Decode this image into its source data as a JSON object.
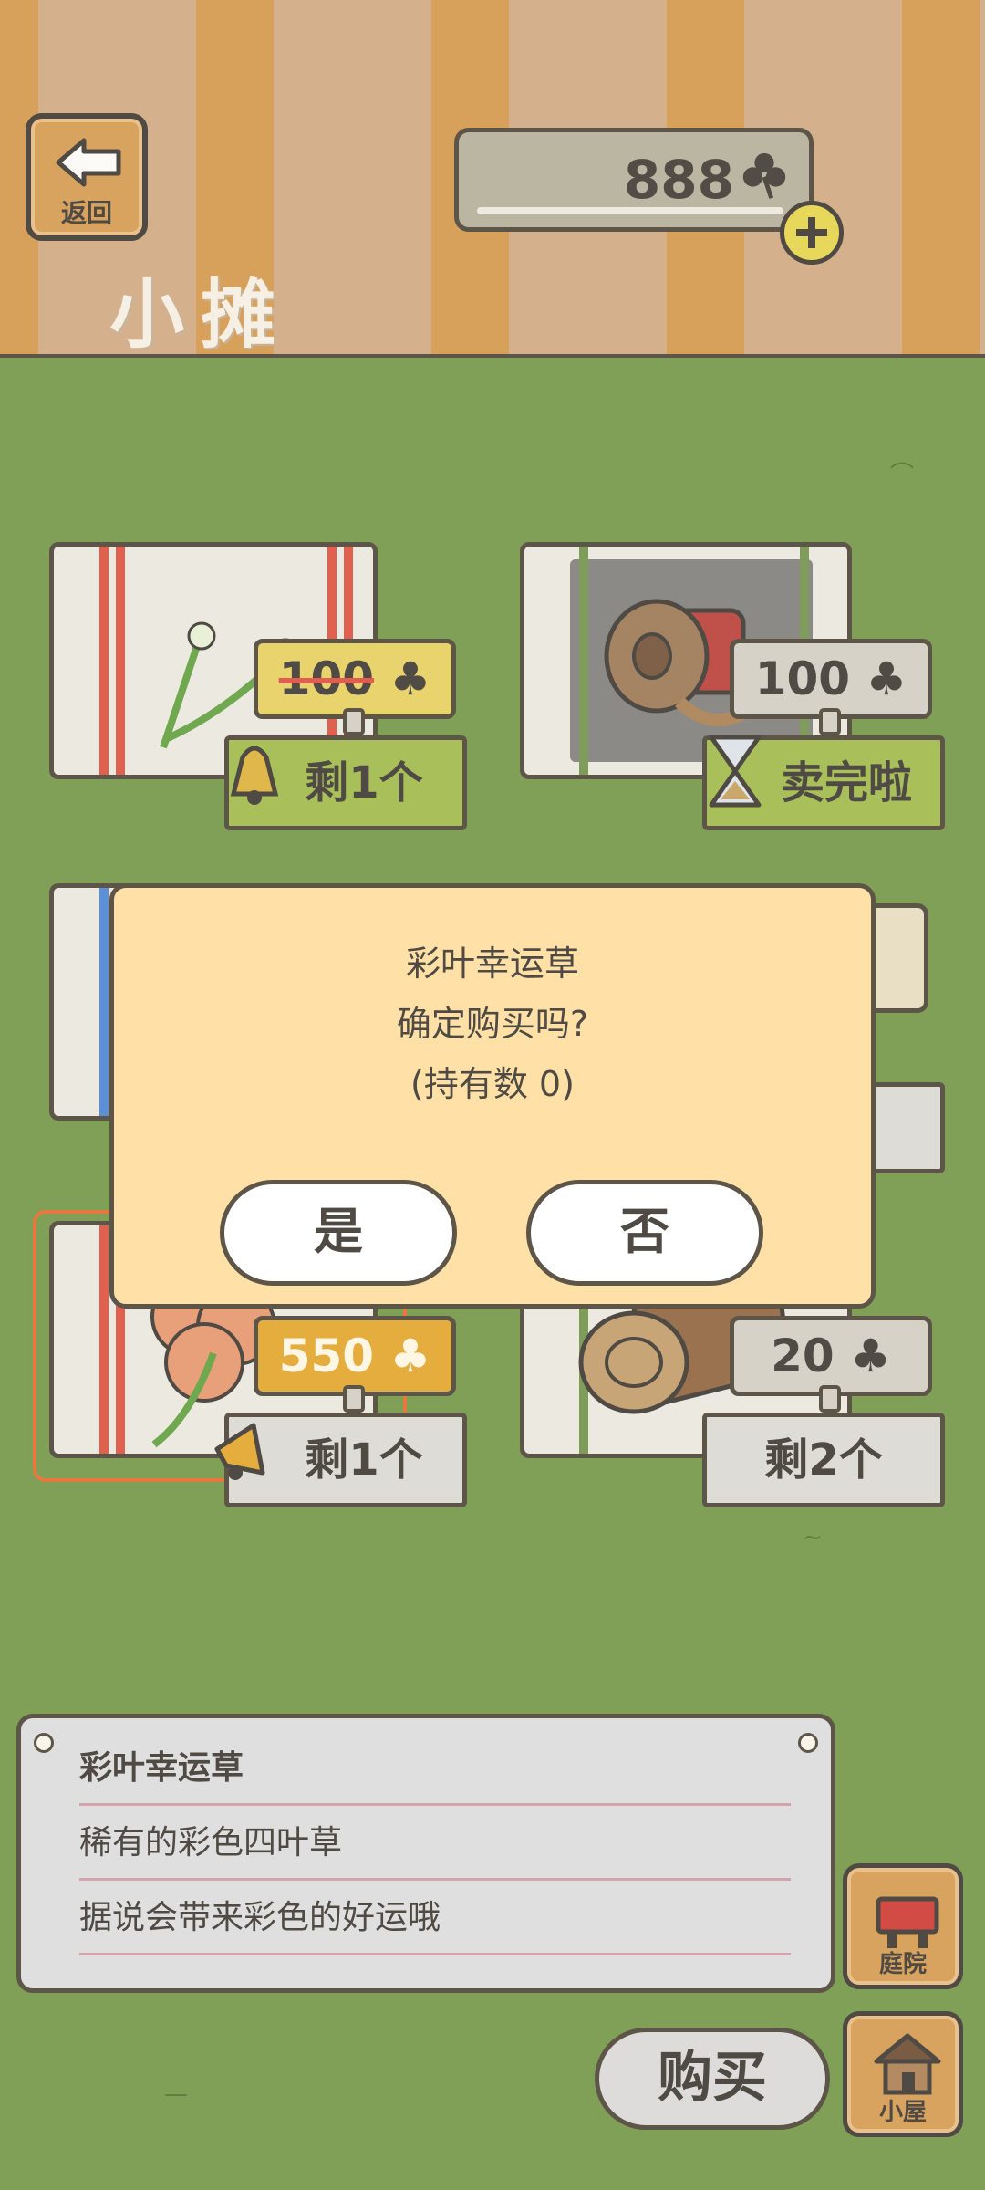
{
  "header": {
    "back_label": "返回",
    "shop_title": "小摊",
    "currency_amount": "888"
  },
  "items": [
    {
      "name": "item-1",
      "price": "100",
      "status": "剩1个",
      "strikethrough": true
    },
    {
      "name": "item-2",
      "price": "100",
      "status": "卖完啦",
      "strikethrough": false
    },
    {
      "name": "item-5",
      "price": "550",
      "status": "剩1个",
      "strikethrough": false
    },
    {
      "name": "item-6",
      "price": "20",
      "status": "剩2个",
      "strikethrough": false
    }
  ],
  "dialog": {
    "line1": "彩叶幸运草",
    "line2": "确定购买吗?",
    "line3": "(持有数 0)",
    "yes_label": "是",
    "no_label": "否"
  },
  "description": {
    "title": "彩叶幸运草",
    "line1": "稀有的彩色四叶草",
    "line2": "据说会带来彩色的好运哦"
  },
  "buy_label": "购买",
  "nav": {
    "yard_label": "庭院",
    "house_label": "小屋"
  },
  "colors": {
    "grass": "#809f57",
    "stripe_orange": "#d8a15b",
    "stripe_beige": "#d4b08d",
    "dialog_bg": "#ffe0a6",
    "price_gold": "#e5ad3d",
    "status_green": "#a9c05a"
  }
}
